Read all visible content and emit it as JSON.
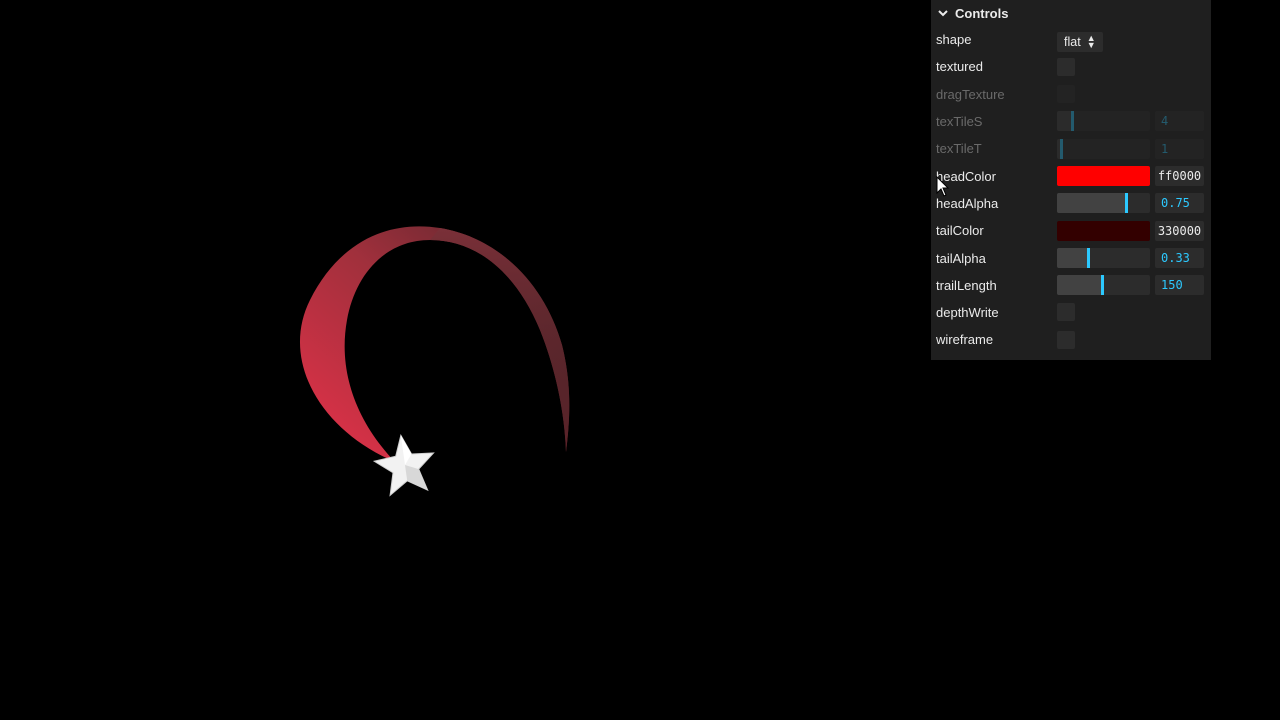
{
  "scene": {
    "background": "#000000",
    "trail_head_color": "#e8324a",
    "trail_tail_color": "#8a3a45",
    "star_color": "#f2f2f2",
    "star_icon": "star-icon"
  },
  "gui": {
    "title": "Controls",
    "background": "#1f1f1f",
    "accent": "#2cc9ff",
    "controls": {
      "shape": {
        "label": "shape",
        "value": "flat"
      },
      "textured": {
        "label": "textured",
        "checked": false
      },
      "dragTexture": {
        "label": "dragTexture",
        "checked": false,
        "disabled": true
      },
      "texTileS": {
        "label": "texTileS",
        "value": "4",
        "disabled": true
      },
      "texTileT": {
        "label": "texTileT",
        "value": "1",
        "disabled": true
      },
      "headColor": {
        "label": "headColor",
        "value": "ff0000",
        "swatch": "#ff0000"
      },
      "headAlpha": {
        "label": "headAlpha",
        "value": "0.75"
      },
      "tailColor": {
        "label": "tailColor",
        "value": "330000",
        "swatch": "#330000"
      },
      "tailAlpha": {
        "label": "tailAlpha",
        "value": "0.33"
      },
      "trailLength": {
        "label": "trailLength",
        "value": "150"
      },
      "depthWrite": {
        "label": "depthWrite",
        "checked": false
      },
      "wireframe": {
        "label": "wireframe",
        "checked": false
      }
    }
  }
}
